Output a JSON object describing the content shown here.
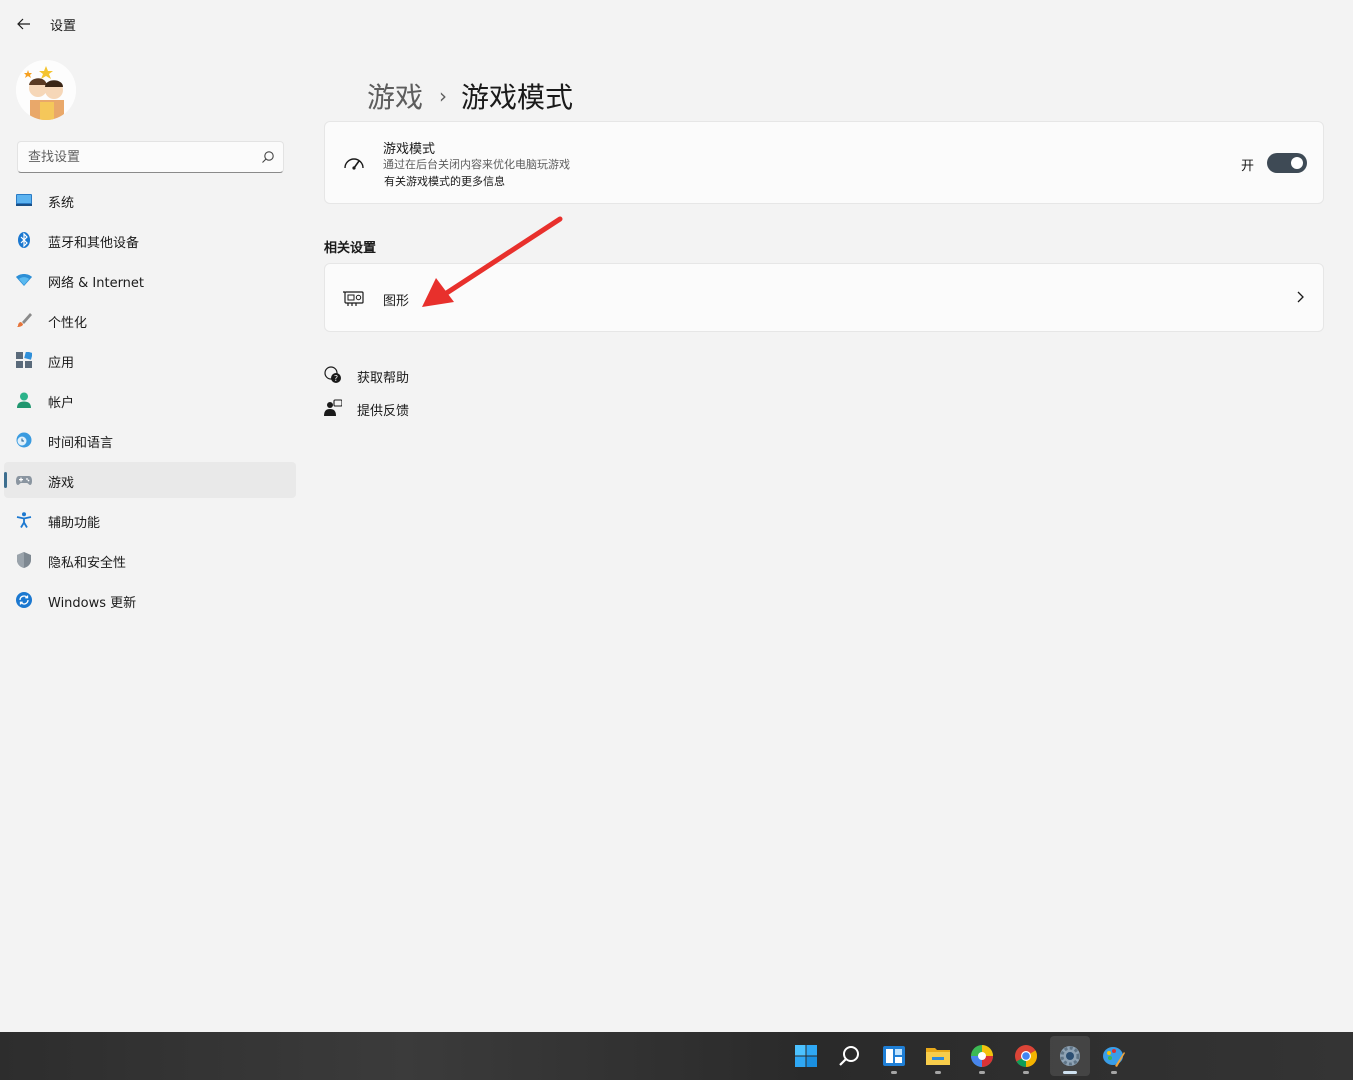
{
  "window": {
    "title": "设置"
  },
  "search": {
    "placeholder": "查找设置"
  },
  "sidebar": {
    "items": [
      {
        "label": "系统",
        "icon": "monitor-icon"
      },
      {
        "label": "蓝牙和其他设备",
        "icon": "bluetooth-icon"
      },
      {
        "label": "网络 & Internet",
        "icon": "wifi-icon"
      },
      {
        "label": "个性化",
        "icon": "brush-icon"
      },
      {
        "label": "应用",
        "icon": "apps-icon"
      },
      {
        "label": "帐户",
        "icon": "person-icon"
      },
      {
        "label": "时间和语言",
        "icon": "globe-clock-icon"
      },
      {
        "label": "游戏",
        "icon": "gamepad-icon",
        "active": true
      },
      {
        "label": "辅助功能",
        "icon": "accessibility-icon"
      },
      {
        "label": "隐私和安全性",
        "icon": "shield-icon"
      },
      {
        "label": "Windows 更新",
        "icon": "update-icon"
      }
    ]
  },
  "breadcrumb": {
    "parent": "游戏",
    "separator": "›",
    "current": "游戏模式"
  },
  "game_mode": {
    "title": "游戏模式",
    "description": "通过在后台关闭内容来优化电脑玩游戏",
    "link": "有关游戏模式的更多信息",
    "toggle_label": "开",
    "enabled": true
  },
  "related": {
    "title": "相关设置",
    "graphics_label": "图形"
  },
  "help": {
    "get_help": "获取帮助",
    "feedback": "提供反馈"
  },
  "colors": {
    "accent": "#3d6e8f",
    "toggle_on": "#3e4a55",
    "annotation_arrow": "#e8302c"
  },
  "taskbar": {
    "apps": [
      "start-icon",
      "search-icon",
      "widgets-icon",
      "file-explorer-icon",
      "pinwheel-app-icon",
      "chrome-icon",
      "settings-icon",
      "paint-icon"
    ]
  }
}
